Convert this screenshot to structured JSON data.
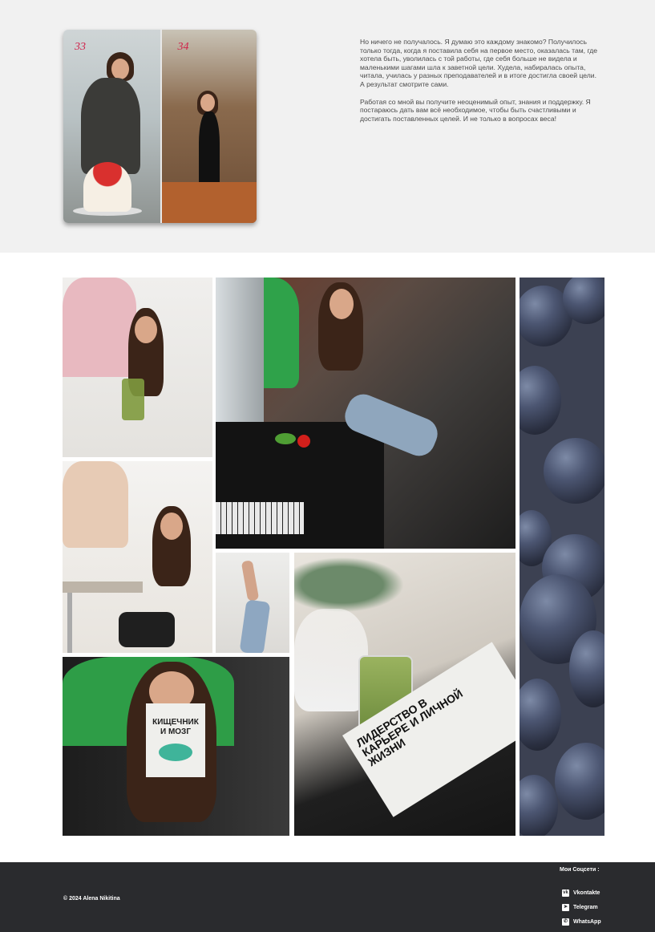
{
  "before_after": {
    "before_age": "33",
    "after_age": "34"
  },
  "intro": {
    "paragraph_1": "Но ничего не получалось. Я думаю это каждому знакомо? Получилось только тогда, когда я поставила себя на первое место, оказалась там, где хотела быть, уволилась с той работы, где себя больше не видела и маленькими шагами шла к заветной цели. Худела, набиралась опыта, читала, училась у разных преподавателей и в итоге достигла своей цели. А результат смотрите сами.",
    "paragraph_2": "Работая со мной вы получите неоценимый опыт, знания и поддержку. Я постараюсь дать вам всё необходимое, чтобы быть счастливыми и достигать поставленных целей. И не только в вопросах веса!"
  },
  "gallery": {
    "book_1_title": "КИЩЕЧНИК И МОЗГ",
    "book_2_title": "ЛИДЕРСТВО В КАРЬЕРЕ И ЛИЧНОЙ ЖИЗНИ"
  },
  "footer": {
    "copyright": "© 2024 Alena Nikitina",
    "social_title": "Мои Соцсети :",
    "links": [
      {
        "label": "Vkontakte",
        "icon": "vk-icon"
      },
      {
        "label": "Telegram",
        "icon": "telegram-icon"
      },
      {
        "label": "WhatsApp",
        "icon": "whatsapp-icon"
      }
    ]
  },
  "colors": {
    "top_bg": "#f1f1f1",
    "footer_bg": "#2a2b2e",
    "age_label": "#d0214a"
  }
}
